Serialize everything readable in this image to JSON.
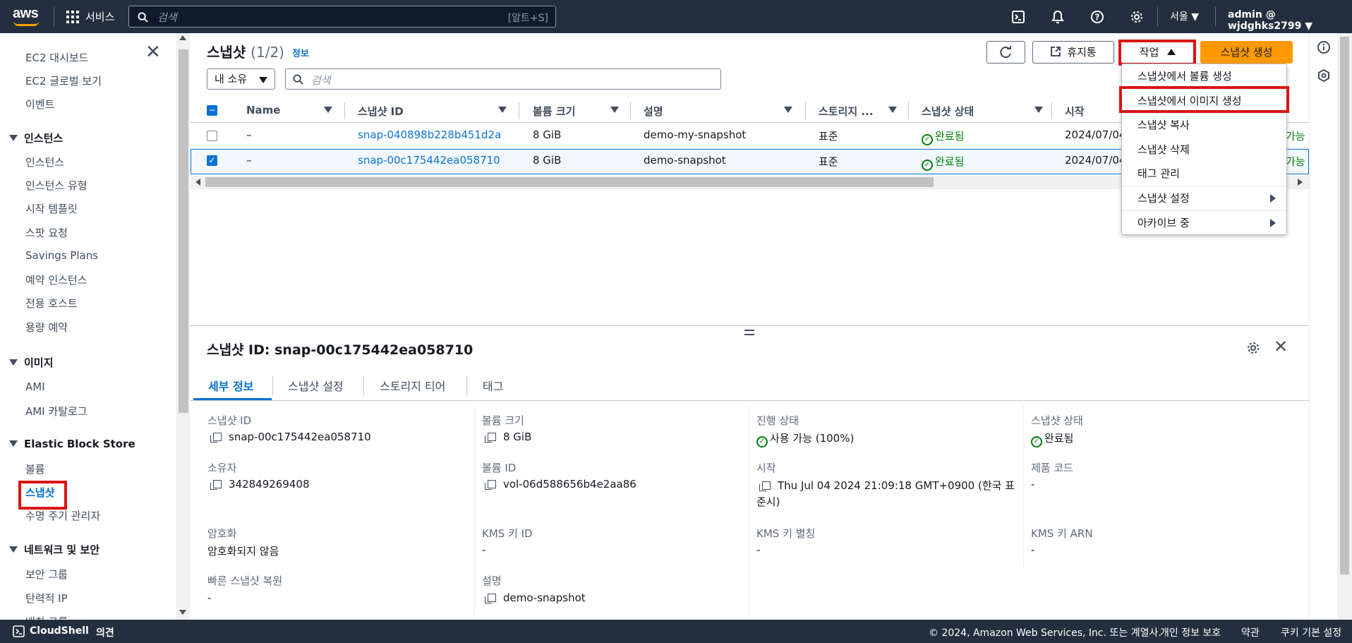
{
  "topbar": {
    "logo": "aws",
    "services": "서비스",
    "search_placeholder": "검색",
    "search_shortcut": "[알트+S]",
    "region": "서울 ▼",
    "account": "admin @ wjdghks2799 ▼",
    "icons": [
      "cloudshell-icon",
      "bell-icon",
      "help-icon",
      "gear-icon"
    ]
  },
  "sidebar": {
    "items": [
      {
        "label": "EC2 대시보드"
      },
      {
        "label": "EC2 글로벌 보기"
      },
      {
        "label": "이벤트"
      }
    ],
    "sections": [
      {
        "title": "인스턴스",
        "items": [
          "인스턴스",
          "인스턴스 유형",
          "시작 템플릿",
          "스팟 요청",
          "Savings Plans",
          "예약 인스턴스",
          "전용 호스트",
          "용량 예약"
        ]
      },
      {
        "title": "이미지",
        "items": [
          "AMI",
          "AMI 카탈로그"
        ]
      },
      {
        "title": "Elastic Block Store",
        "items": [
          "볼륨",
          "스냅샷",
          "수명 주기 관리자"
        ]
      },
      {
        "title": "네트워크 및 보안",
        "items": [
          "보안 그룹",
          "탄력적 IP",
          "배치 그룹"
        ]
      }
    ]
  },
  "header": {
    "title": "스냅샷",
    "count": "(1/2)",
    "info": "정보",
    "refresh_icon": "refresh-icon",
    "recycle_label": "휴지통",
    "actions_label": "작업",
    "create_label": "스냅샷 생성",
    "filter_select": "내 소유",
    "search_placeholder": "검색"
  },
  "table": {
    "columns": [
      "Name",
      "스냅샷 ID",
      "볼륨 크기",
      "설명",
      "스토리지 ...",
      "스냅샷 상태",
      "시작"
    ],
    "rows": [
      {
        "selected": false,
        "name": "–",
        "id": "snap-040898b228b451d2a",
        "size": "8 GiB",
        "desc": "demo-my-snapshot",
        "storage": "표준",
        "status": "완료됨",
        "start": "2024/07/04",
        "extra": "가능 ("
      },
      {
        "selected": true,
        "name": "–",
        "id": "snap-00c175442ea058710",
        "size": "8 GiB",
        "desc": "demo-snapshot",
        "storage": "표준",
        "status": "완료됨",
        "start": "2024/07/04",
        "extra": "가능 ("
      }
    ]
  },
  "menu": {
    "items": [
      "스냅샷에서 볼륨 생성",
      "스냅샷에서 이미지 생성",
      "스냅샷 복사",
      "스냅샷 삭제",
      "태그 관리",
      "스냅샷 설정",
      "아카이브 중"
    ]
  },
  "detail": {
    "title": "스냅샷 ID: snap-00c175442ea058710",
    "tabs": [
      "세부 정보",
      "스냅샷 설정",
      "스토리지 티어",
      "태그"
    ],
    "fields": {
      "snap_id_label": "스냅샷 ID",
      "snap_id": "snap-00c175442ea058710",
      "vol_size_label": "볼륨 크기",
      "vol_size": "8 GiB",
      "progress_label": "진행 상태",
      "progress": "사용 가능 (100%)",
      "state_label": "스냅샷 상태",
      "state": "완료됨",
      "owner_label": "소유자",
      "owner": "342849269408",
      "vol_id_label": "볼륨 ID",
      "vol_id": "vol-06d588656b4e2aa86",
      "start_label": "시작",
      "start_1": "Thu Jul 04 2024 21:09:18 GMT+0900 (한국 표",
      "start_2": "준시)",
      "product_label": "제품 코드",
      "product": "-",
      "enc_label": "암호화",
      "enc": "암호화되지 않음",
      "kms_id_label": "KMS 키 ID",
      "kms_id": "-",
      "kms_alias_label": "KMS 키 별칭",
      "kms_alias": "-",
      "kms_arn_label": "KMS 키 ARN",
      "kms_arn": "-",
      "fast_label": "빠른 스냅샷 복원",
      "fast": "-",
      "desc_label": "설명",
      "desc": "demo-snapshot"
    }
  },
  "footer": {
    "cloudshell": "CloudShell",
    "feedback": "의견",
    "copyright": "© 2024, Amazon Web Services, Inc. 또는 계열사.",
    "privacy": "개인 정보 보호",
    "terms": "약관",
    "cookies": "쿠키 기본 설정"
  },
  "colors": {
    "accent": "#0972d3",
    "primary": "#ff9900",
    "nav": "#232f3e",
    "highlight": "#d91515",
    "success": "#037f0c"
  }
}
